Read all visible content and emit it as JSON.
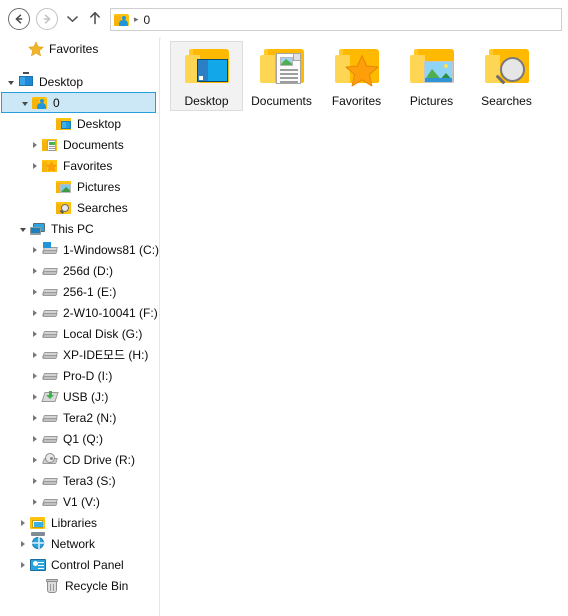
{
  "toolbar": {
    "back_label": "Back",
    "forward_label": "Forward",
    "recent_label": "Recent locations",
    "up_label": "Up one level"
  },
  "address": {
    "icon": "user-folder-icon",
    "separator": "▸",
    "text": "0"
  },
  "sidebar": {
    "items": [
      {
        "label": "Favorites",
        "icon": "star-icon",
        "indent": 14,
        "expander": "none",
        "selected": false
      },
      {
        "label": "",
        "icon": "spacer",
        "indent": 0,
        "expander": "none",
        "selected": false,
        "spacer": true
      },
      {
        "label": "Desktop",
        "icon": "monitor-icon",
        "indent": 4,
        "expander": "open",
        "selected": false
      },
      {
        "label": "0",
        "icon": "user-folder-icon",
        "indent": 16,
        "expander": "open",
        "selected": true
      },
      {
        "label": "Desktop",
        "icon": "desktop-folder-icon",
        "indent": 42,
        "expander": "none",
        "selected": false
      },
      {
        "label": "Documents",
        "icon": "documents-folder-icon",
        "indent": 28,
        "expander": "closed",
        "selected": false
      },
      {
        "label": "Favorites",
        "icon": "favorites-folder-icon",
        "indent": 28,
        "expander": "closed",
        "selected": false
      },
      {
        "label": "Pictures",
        "icon": "pictures-folder-icon",
        "indent": 42,
        "expander": "none",
        "selected": false
      },
      {
        "label": "Searches",
        "icon": "searches-folder-icon",
        "indent": 42,
        "expander": "none",
        "selected": false
      },
      {
        "label": "This PC",
        "icon": "this-pc-icon",
        "indent": 16,
        "expander": "open",
        "selected": false
      },
      {
        "label": "1-Windows81 (C:)",
        "icon": "windows-drive-icon",
        "indent": 28,
        "expander": "closed",
        "selected": false
      },
      {
        "label": "256d (D:)",
        "icon": "drive-icon",
        "indent": 28,
        "expander": "closed",
        "selected": false
      },
      {
        "label": "256-1 (E:)",
        "icon": "drive-icon",
        "indent": 28,
        "expander": "closed",
        "selected": false
      },
      {
        "label": "2-W10-10041 (F:)",
        "icon": "drive-icon",
        "indent": 28,
        "expander": "closed",
        "selected": false
      },
      {
        "label": "Local Disk (G:)",
        "icon": "drive-icon",
        "indent": 28,
        "expander": "closed",
        "selected": false
      },
      {
        "label": "XP-IDE모드 (H:)",
        "icon": "drive-icon",
        "indent": 28,
        "expander": "closed",
        "selected": false
      },
      {
        "label": "Pro-D (I:)",
        "icon": "drive-icon",
        "indent": 28,
        "expander": "closed",
        "selected": false
      },
      {
        "label": "USB (J:)",
        "icon": "usb-drive-icon",
        "indent": 28,
        "expander": "closed",
        "selected": false
      },
      {
        "label": "Tera2 (N:)",
        "icon": "drive-icon",
        "indent": 28,
        "expander": "closed",
        "selected": false
      },
      {
        "label": "Q1 (Q:)",
        "icon": "drive-icon",
        "indent": 28,
        "expander": "closed",
        "selected": false
      },
      {
        "label": "CD Drive (R:)",
        "icon": "cd-drive-icon",
        "indent": 28,
        "expander": "closed",
        "selected": false
      },
      {
        "label": "Tera3 (S:)",
        "icon": "drive-icon",
        "indent": 28,
        "expander": "closed",
        "selected": false
      },
      {
        "label": "V1 (V:)",
        "icon": "drive-icon",
        "indent": 28,
        "expander": "closed",
        "selected": false
      },
      {
        "label": "Libraries",
        "icon": "libraries-icon",
        "indent": 16,
        "expander": "closed",
        "selected": false
      },
      {
        "label": "Network",
        "icon": "network-icon",
        "indent": 16,
        "expander": "closed",
        "selected": false
      },
      {
        "label": "Control Panel",
        "icon": "control-panel-icon",
        "indent": 16,
        "expander": "closed",
        "selected": false
      },
      {
        "label": "Recycle Bin",
        "icon": "recycle-bin-icon",
        "indent": 30,
        "expander": "none",
        "selected": false
      }
    ]
  },
  "content": {
    "items": [
      {
        "label": "Desktop",
        "icon": "desktop-folder-icon",
        "selected": true
      },
      {
        "label": "Documents",
        "icon": "documents-folder-icon",
        "selected": false
      },
      {
        "label": "Favorites",
        "icon": "favorites-folder-icon",
        "selected": false
      },
      {
        "label": "Pictures",
        "icon": "pictures-folder-icon",
        "selected": false
      },
      {
        "label": "Searches",
        "icon": "searches-folder-icon",
        "selected": false
      }
    ]
  },
  "colors": {
    "selection_fill": "#cce8f6",
    "selection_border": "#26a0da",
    "folder_yellow": "#ffb900",
    "accent_blue": "#12a7e8",
    "panel_border": "#e6e6e6"
  }
}
